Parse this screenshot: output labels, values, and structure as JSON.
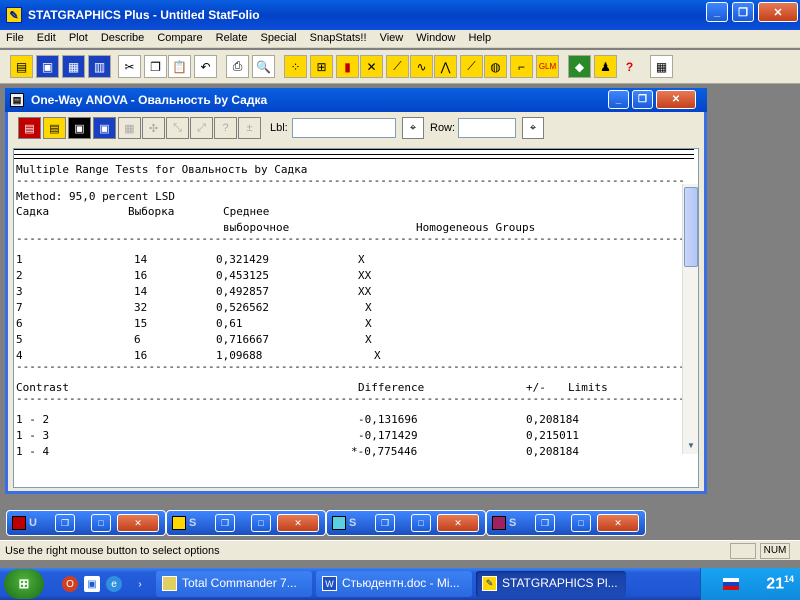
{
  "app": {
    "title": "STATGRAPHICS Plus - Untitled StatFolio"
  },
  "menu": [
    "File",
    "Edit",
    "Plot",
    "Describe",
    "Compare",
    "Relate",
    "Special",
    "SnapStats!!",
    "View",
    "Window",
    "Help"
  ],
  "child": {
    "title": "One-Way ANOVA - Овальность by Садка",
    "lbl_label": "Lbl:",
    "row_label": "Row:"
  },
  "report": {
    "title": "Multiple Range Tests for Овальность by Садка",
    "method": "Method: 95,0 percent LSD",
    "headers": [
      "Садка",
      "Выборка",
      "Среднее",
      "выборочное",
      "Homogeneous Groups"
    ],
    "groups": [
      {
        "level": "1",
        "count": "14",
        "mean": "0,321429",
        "group": "X"
      },
      {
        "level": "2",
        "count": "16",
        "mean": "0,453125",
        "group": "XX"
      },
      {
        "level": "3",
        "count": "14",
        "mean": "0,492857",
        "group": "XX"
      },
      {
        "level": "7",
        "count": "32",
        "mean": "0,526562",
        "group": "X"
      },
      {
        "level": "6",
        "count": "15",
        "mean": "0,61",
        "group": "X"
      },
      {
        "level": "5",
        "count": "6",
        "mean": "0,716667",
        "group": "X"
      },
      {
        "level": "4",
        "count": "16",
        "mean": "1,09688",
        "group": "X"
      }
    ],
    "contrast_headers": [
      "Contrast",
      "Difference",
      "+/-",
      "Limits"
    ],
    "contrasts": [
      {
        "pair": "1 - 2",
        "diff": "-0,131696",
        "limit": "0,208184"
      },
      {
        "pair": "1 - 3",
        "diff": "-0,171429",
        "limit": "0,215011"
      },
      {
        "pair": "1 - 4",
        "diff": "*-0,775446",
        "limit": "0,208184"
      }
    ]
  },
  "minimized": [
    {
      "label": "U"
    },
    {
      "label": "S"
    },
    {
      "label": "S"
    },
    {
      "label": "S"
    }
  ],
  "status": {
    "text": "Use the right mouse button to select options",
    "num": "NUM"
  },
  "taskbar": {
    "buttons": [
      {
        "label": "Total Commander 7..."
      },
      {
        "label": "Стьюдентн.doc - Mi..."
      },
      {
        "label": "STATGRAPHICS Pl..."
      }
    ],
    "time_hour": "21",
    "time_min": "14"
  }
}
